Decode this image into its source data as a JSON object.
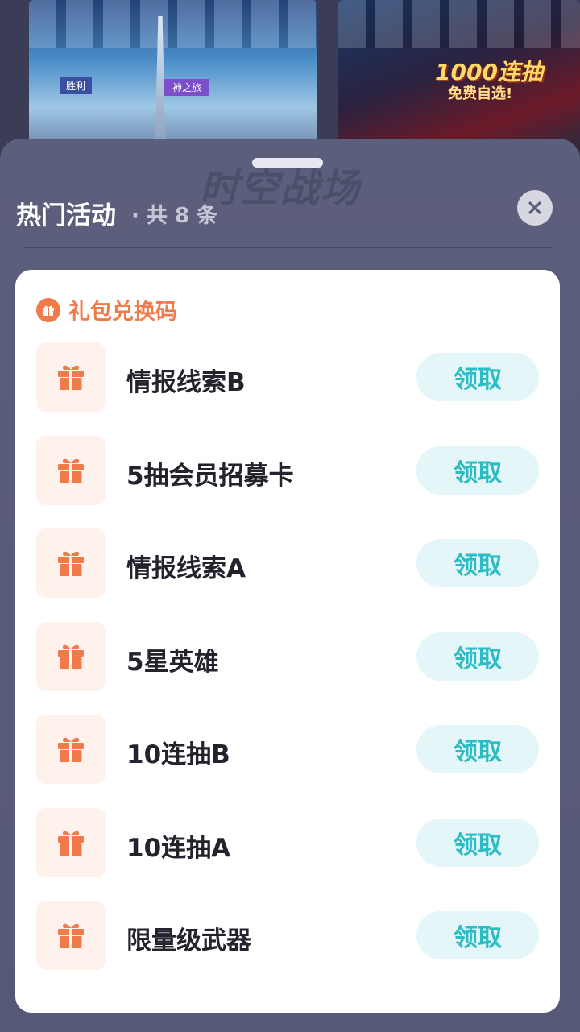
{
  "banners": {
    "left_tag": "胜利",
    "left_tag2": "神之旅",
    "right_promo": "1000连抽",
    "right_promo_sub": "免费自选!"
  },
  "sheet": {
    "watermark": "时空战场",
    "title": "热门活动",
    "count": "· 共 8 条"
  },
  "card": {
    "header_label": "礼包兑换码",
    "claim_label": "领取",
    "items": [
      {
        "name": "情报线索B"
      },
      {
        "name": "5抽会员招募卡"
      },
      {
        "name": "情报线索A"
      },
      {
        "name": "5星英雄"
      },
      {
        "name": "10连抽B"
      },
      {
        "name": "10连抽A"
      },
      {
        "name": "限量级武器"
      }
    ]
  },
  "colors": {
    "accent_orange": "#f07a4a",
    "claim_text": "#2bbcc4",
    "claim_bg": "#e4f6f8",
    "sheet_bg": "#5c5f7c"
  }
}
